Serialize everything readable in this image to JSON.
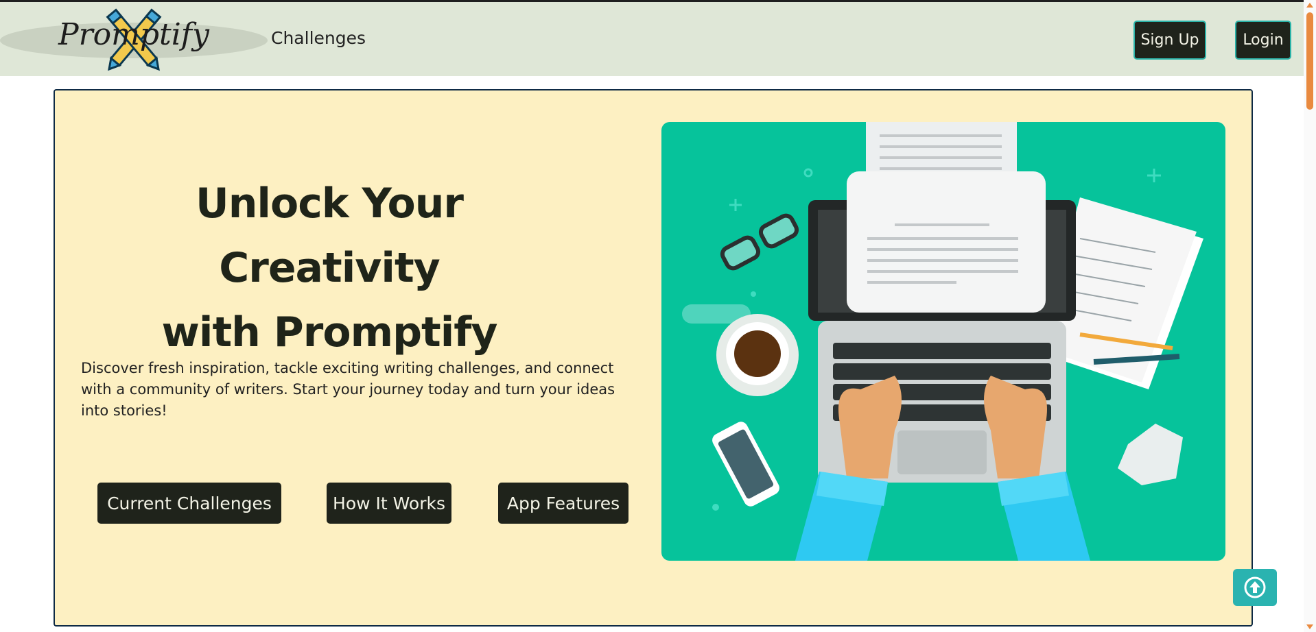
{
  "brand": {
    "logo_text": "Promptify"
  },
  "nav": {
    "challenges_label": "Challenges",
    "signup_label": "Sign Up",
    "login_label": "Login"
  },
  "hero": {
    "title_line1": "Unlock Your Creativity",
    "title_line2": "with Promptify",
    "description": "Discover fresh inspiration, tackle exciting writing challenges, and connect with a community of writers. Start your journey today and turn your ideas into stories!",
    "buttons": {
      "current_challenges": "Current Challenges",
      "how_it_works": "How It Works",
      "app_features": "App Features"
    },
    "illustration_icon": "laptop-typing-illustration"
  },
  "colors": {
    "navbar_bg": "#dfe7d7",
    "hero_bg": "#fdf0c2",
    "button_bg": "#1f231b",
    "accent_teal": "#2ab3b0",
    "illustration_bg": "#06c39b",
    "scrollbar_accent": "#e98a3f"
  }
}
